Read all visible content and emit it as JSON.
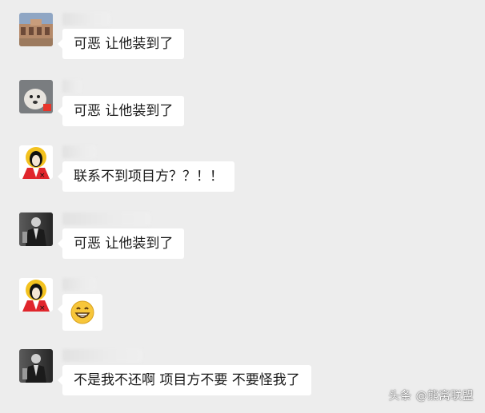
{
  "messages": [
    {
      "avatar": "building-photo-avatar",
      "text": "可恶 让他装到了"
    },
    {
      "avatar": "dog-photo-avatar",
      "text": "可恶 让他装到了"
    },
    {
      "avatar": "anime-character-avatar",
      "text": "联系不到项目方？？！！"
    },
    {
      "avatar": "suited-man-avatar",
      "text": "可恶 让他装到了"
    },
    {
      "avatar": "anime-character-avatar",
      "text": "",
      "emoji": "grinning-face-emoji"
    },
    {
      "avatar": "suited-man-avatar",
      "text": "不是我不还啊 项目方不要 不要怪我了"
    }
  ],
  "watermark": "头条 @熊窝联盟",
  "colors": {
    "background": "#ededed",
    "bubble": "#ffffff",
    "text": "#1a1a1a"
  }
}
